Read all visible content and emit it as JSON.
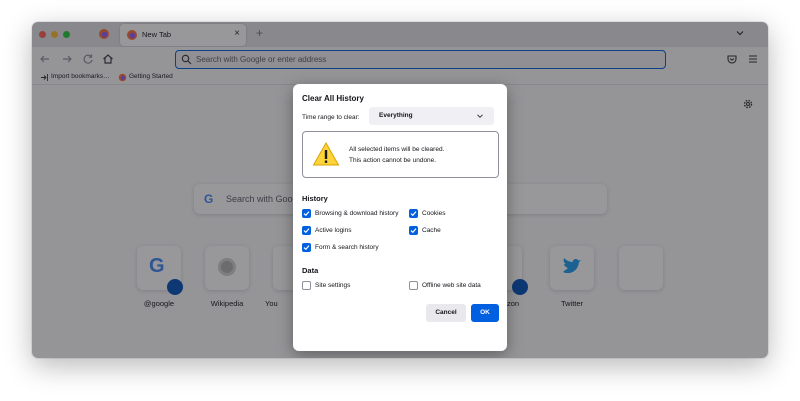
{
  "window": {
    "tab_title": "New Tab",
    "new_tab_symbol": "+",
    "close_symbol": "×"
  },
  "toolbar": {
    "url_placeholder": "Search with Google or enter address"
  },
  "bookmarks": {
    "import_label": "Import bookmarks…",
    "getting_started_label": "Getting Started"
  },
  "newtab": {
    "search_placeholder": "Search with Goog",
    "shortcuts": [
      {
        "label": "@google"
      },
      {
        "label": "Wikipedia"
      },
      {
        "label": "You"
      },
      {
        "label": "zon"
      },
      {
        "label": "Twitter"
      }
    ]
  },
  "dialog": {
    "title": "Clear All History",
    "time_range_label": "Time range to clear:",
    "time_range_value": "Everything",
    "warning_line1": "All selected items will be cleared.",
    "warning_line2": "This action cannot be undone.",
    "history_heading": "History",
    "history_items": [
      {
        "label": "Browsing & download history",
        "checked": true
      },
      {
        "label": "Cookies",
        "checked": true
      },
      {
        "label": "Active logins",
        "checked": true
      },
      {
        "label": "Cache",
        "checked": true
      },
      {
        "label": "Form & search history",
        "checked": true
      }
    ],
    "data_heading": "Data",
    "data_items": [
      {
        "label": "Site settings",
        "checked": false
      },
      {
        "label": "Offline web site data",
        "checked": false
      }
    ],
    "cancel_label": "Cancel",
    "ok_label": "OK"
  },
  "colors": {
    "accent": "#0060df",
    "overlay": "#1a1a20"
  }
}
